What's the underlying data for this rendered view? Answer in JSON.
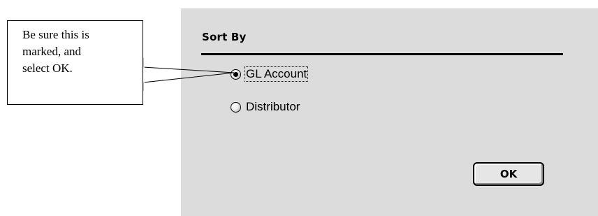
{
  "dialog": {
    "group_title": "Sort By",
    "options": [
      {
        "label": "GL Account",
        "selected": true,
        "focused": true
      },
      {
        "label": "Distributor",
        "selected": false,
        "focused": false
      }
    ],
    "ok_label": "OK"
  },
  "callout": {
    "lines": [
      "Be sure this is",
      "marked, and",
      "select OK."
    ]
  },
  "colors": {
    "dialog_background": "#dcdcdc",
    "page_background": "#ffffff",
    "text": "#000000"
  }
}
